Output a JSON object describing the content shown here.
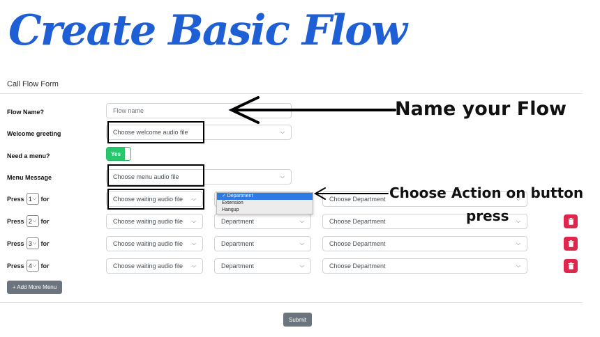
{
  "hero_title": "Create Basic Flow",
  "form": {
    "header": "Call Flow Form",
    "flow_name": {
      "label": "Flow Name?",
      "placeholder": "Flow name",
      "value": ""
    },
    "welcome": {
      "label": "Welcome greeting",
      "selected": "Choose welcome audio file"
    },
    "need_menu": {
      "label": "Need a menu?",
      "toggle_label": "Yes",
      "value": true
    },
    "menu_message": {
      "label": "Menu Message",
      "selected": "Choose menu audio file"
    },
    "press_prefix": "Press",
    "press_suffix": "for",
    "rows": [
      {
        "key": "1",
        "audio": "Choose waiting audio file",
        "action": "Department",
        "target": "Choose Department",
        "action_open": true
      },
      {
        "key": "2",
        "audio": "Choose waiting audio file",
        "action": "Department",
        "target": "Choose Department"
      },
      {
        "key": "3",
        "audio": "Choose waiting audio file",
        "action": "Department",
        "target": "Choose Department"
      },
      {
        "key": "4",
        "audio": "Choose waiting audio file",
        "action": "Department",
        "target": "Choose Department"
      }
    ],
    "action_options": [
      "✓ Department",
      "Extension",
      "Hangup"
    ],
    "add_menu_label": "+ Add More Menu",
    "submit_label": "Submit"
  },
  "annotations": {
    "name_flow": "Name your Flow",
    "choose_action_line1": "Choose Action on button",
    "choose_action_line2": "press"
  },
  "colors": {
    "title_blue": "#1e5fd6",
    "toggle_green": "#28c76f",
    "delete_red": "#e0264d",
    "button_gray": "#6c757d",
    "dropdown_selected": "#2f7be4"
  }
}
